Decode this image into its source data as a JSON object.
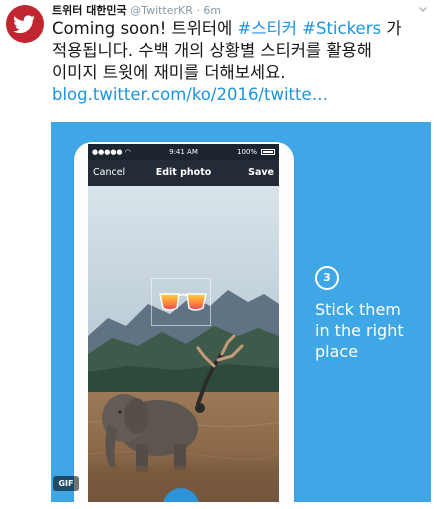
{
  "account": {
    "display_name": "트위터 대한민국",
    "handle": "@TwitterKR",
    "separator": "·",
    "time": "6m"
  },
  "tweet": {
    "lines": [
      [
        {
          "text": "Coming soon! 트위터에 ",
          "type": "text"
        },
        {
          "text": "#스티커",
          "type": "hashtag"
        },
        {
          "text": " ",
          "type": "text"
        },
        {
          "text": "#Stickers",
          "type": "hashtag"
        },
        {
          "text": " 가",
          "type": "text"
        }
      ],
      [
        {
          "text": "적용됩니다. 수백 개의 상황별 스티커를 활용해",
          "type": "text"
        }
      ],
      [
        {
          "text": "이미지 트윗에 재미를 더해보세요.",
          "type": "text"
        }
      ]
    ],
    "link": "blog.twitter.com/ko/2016/twitte…"
  },
  "media": {
    "status_bar": {
      "signal": "●●●●● ◠",
      "time": "9:41 AM",
      "battery": "100%"
    },
    "nav": {
      "cancel": "Cancel",
      "title": "Edit photo",
      "save": "Save"
    },
    "gif_badge": "GIF",
    "step_number": "3",
    "caption_lines": [
      "Stick them",
      "in the right",
      "place"
    ]
  },
  "colors": {
    "brand_red": "#c0262f",
    "link_blue": "#1b95e0",
    "media_blue": "#3fa7e6"
  },
  "icons": [
    "twitter-bird-icon",
    "chevron-down-icon",
    "battery-icon",
    "sunglasses-sticker"
  ]
}
